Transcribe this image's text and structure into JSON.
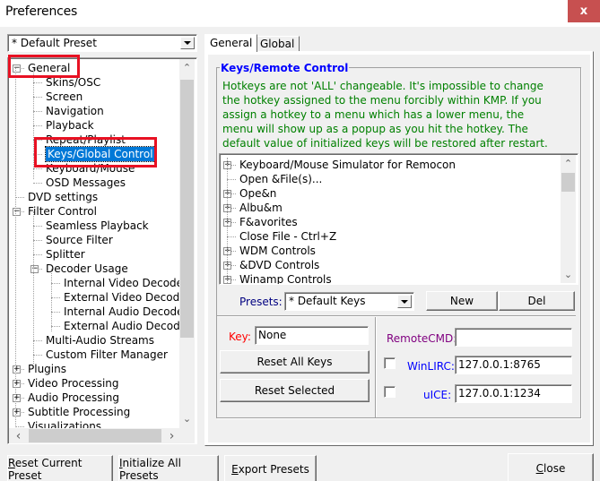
{
  "window": {
    "title": "Preferences",
    "close_glyph": "x"
  },
  "preset_combo": {
    "value": "* Default Preset"
  },
  "tree": {
    "items": [
      {
        "label": "General",
        "expander": "minus"
      },
      {
        "label": "Skins/OSC"
      },
      {
        "label": "Screen"
      },
      {
        "label": "Navigation"
      },
      {
        "label": "Playback"
      },
      {
        "label": "Repeat/Playlist"
      },
      {
        "label": "Keys/Global Control",
        "selected": true
      },
      {
        "label": "Keyboard/Mouse"
      },
      {
        "label": "OSD Messages"
      },
      {
        "label": "DVD settings"
      },
      {
        "label": "Filter Control",
        "expander": "minus"
      },
      {
        "label": "Seamless Playback"
      },
      {
        "label": "Source Filter"
      },
      {
        "label": "Splitter"
      },
      {
        "label": "Decoder Usage",
        "expander": "minus"
      },
      {
        "label": "Internal Video Decoder"
      },
      {
        "label": "External Video Decoder"
      },
      {
        "label": "Internal Audio Decoder"
      },
      {
        "label": "External Audio Decoder"
      },
      {
        "label": "Multi-Audio Streams"
      },
      {
        "label": "Custom Filter Manager"
      },
      {
        "label": "Plugins",
        "expander": "plus"
      },
      {
        "label": "Video Processing",
        "expander": "plus"
      },
      {
        "label": "Audio Processing",
        "expander": "plus"
      },
      {
        "label": "Subtitle Processing",
        "expander": "plus"
      },
      {
        "label": "Visualizations"
      }
    ]
  },
  "tabs": [
    {
      "label": "General",
      "active": true
    },
    {
      "label": "Global",
      "active": false
    }
  ],
  "keys_group": {
    "title": "Keys/Remote Control",
    "info_lines": [
      "Hotkeys are not 'ALL' changeable. It's impossible to change",
      "the hotkey assigned to the menu forcibly within KMP. If you",
      "assign a hotkey to a menu which has a lower menu, the",
      "menu will show up as a popup as you hit the hotkey. The",
      "default value of initialized keys will be restored after restart."
    ],
    "key_items": [
      {
        "label": "Keyboard/Mouse Simulator for Remocon",
        "expander": "plus"
      },
      {
        "label": "Open &File(s)..."
      },
      {
        "label": "Ope&n",
        "expander": "plus"
      },
      {
        "label": "Albu&m",
        "expander": "plus"
      },
      {
        "label": "F&avorites",
        "expander": "plus"
      },
      {
        "label": "Close File - Ctrl+Z"
      },
      {
        "label": "WDM Controls",
        "expander": "plus"
      },
      {
        "label": "&DVD Controls",
        "expander": "plus"
      },
      {
        "label": "Winamp Controls",
        "expander": "plus"
      }
    ]
  },
  "presets": {
    "label": "Presets:",
    "value": "* Default Keys",
    "new_label": "New",
    "del_label": "Del"
  },
  "key_panel": {
    "key_label": "Key:",
    "key_value": "None",
    "reset_all_label": "Reset All Keys",
    "reset_selected_label": "Reset Selected"
  },
  "remote_panel": {
    "remotecmd_label": "RemoteCMD:",
    "remotecmd_value": "",
    "winlirc_label": "WinLIRC:",
    "winlirc_value": "127.0.0.1:8765",
    "winlirc_checked": false,
    "uice_label": "uICE:",
    "uice_value": "127.0.0.1:1234",
    "uice_checked": false
  },
  "bottom_buttons": {
    "reset_current": {
      "mnemonic": "R",
      "rest": "eset Current Preset"
    },
    "initialize_all": {
      "mnemonic": "I",
      "rest": "nitialize All Presets"
    },
    "export": {
      "mnemonic": "E",
      "rest": "xport Presets"
    },
    "close": {
      "mnemonic": "C",
      "rest": "lose"
    }
  },
  "colors": {
    "close_button": "#c75050",
    "selection": "#0078d7",
    "annotation_red": "#e81123",
    "group_title": "#0000ff",
    "info_text": "#008000",
    "key_label": "#ff0000",
    "remotecmd_label": "#800080",
    "winlirc_label": "#0000ff",
    "presets_label": "#000080"
  },
  "scroll": {
    "tree_vertical_position": 0.0,
    "tree_vertical_visible_fraction": 0.75,
    "tree_horizontal_position": 0.0,
    "keys_vertical_position": 0.0
  }
}
